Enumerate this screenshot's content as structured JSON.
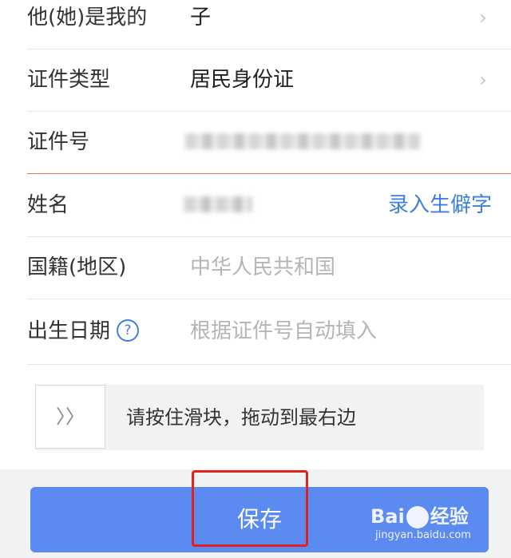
{
  "form": {
    "relation": {
      "label": "他(她)是我的",
      "value": "子"
    },
    "id_type": {
      "label": "证件类型",
      "value": "居民身份证"
    },
    "id_number": {
      "label": "证件号"
    },
    "name": {
      "label": "姓名",
      "rare_char_link": "录入生僻字"
    },
    "nationality": {
      "label": "国籍(地区)",
      "value": "中华人民共和国"
    },
    "birth_date": {
      "label": "出生日期",
      "help_glyph": "?",
      "placeholder": "根据证件号自动填入"
    }
  },
  "slider": {
    "handle_glyph": "〉〉",
    "text": "请按住滑块，拖动到最右边"
  },
  "save_button": {
    "label": "保存"
  },
  "watermark": {
    "logo_left": "Bai",
    "logo_right": "经验",
    "url": "jingyan.baidu.com"
  },
  "colors": {
    "link": "#3d7fe0",
    "button": "#5b8bf0",
    "active_underline": "#e8734a",
    "highlight": "#e0211c"
  }
}
